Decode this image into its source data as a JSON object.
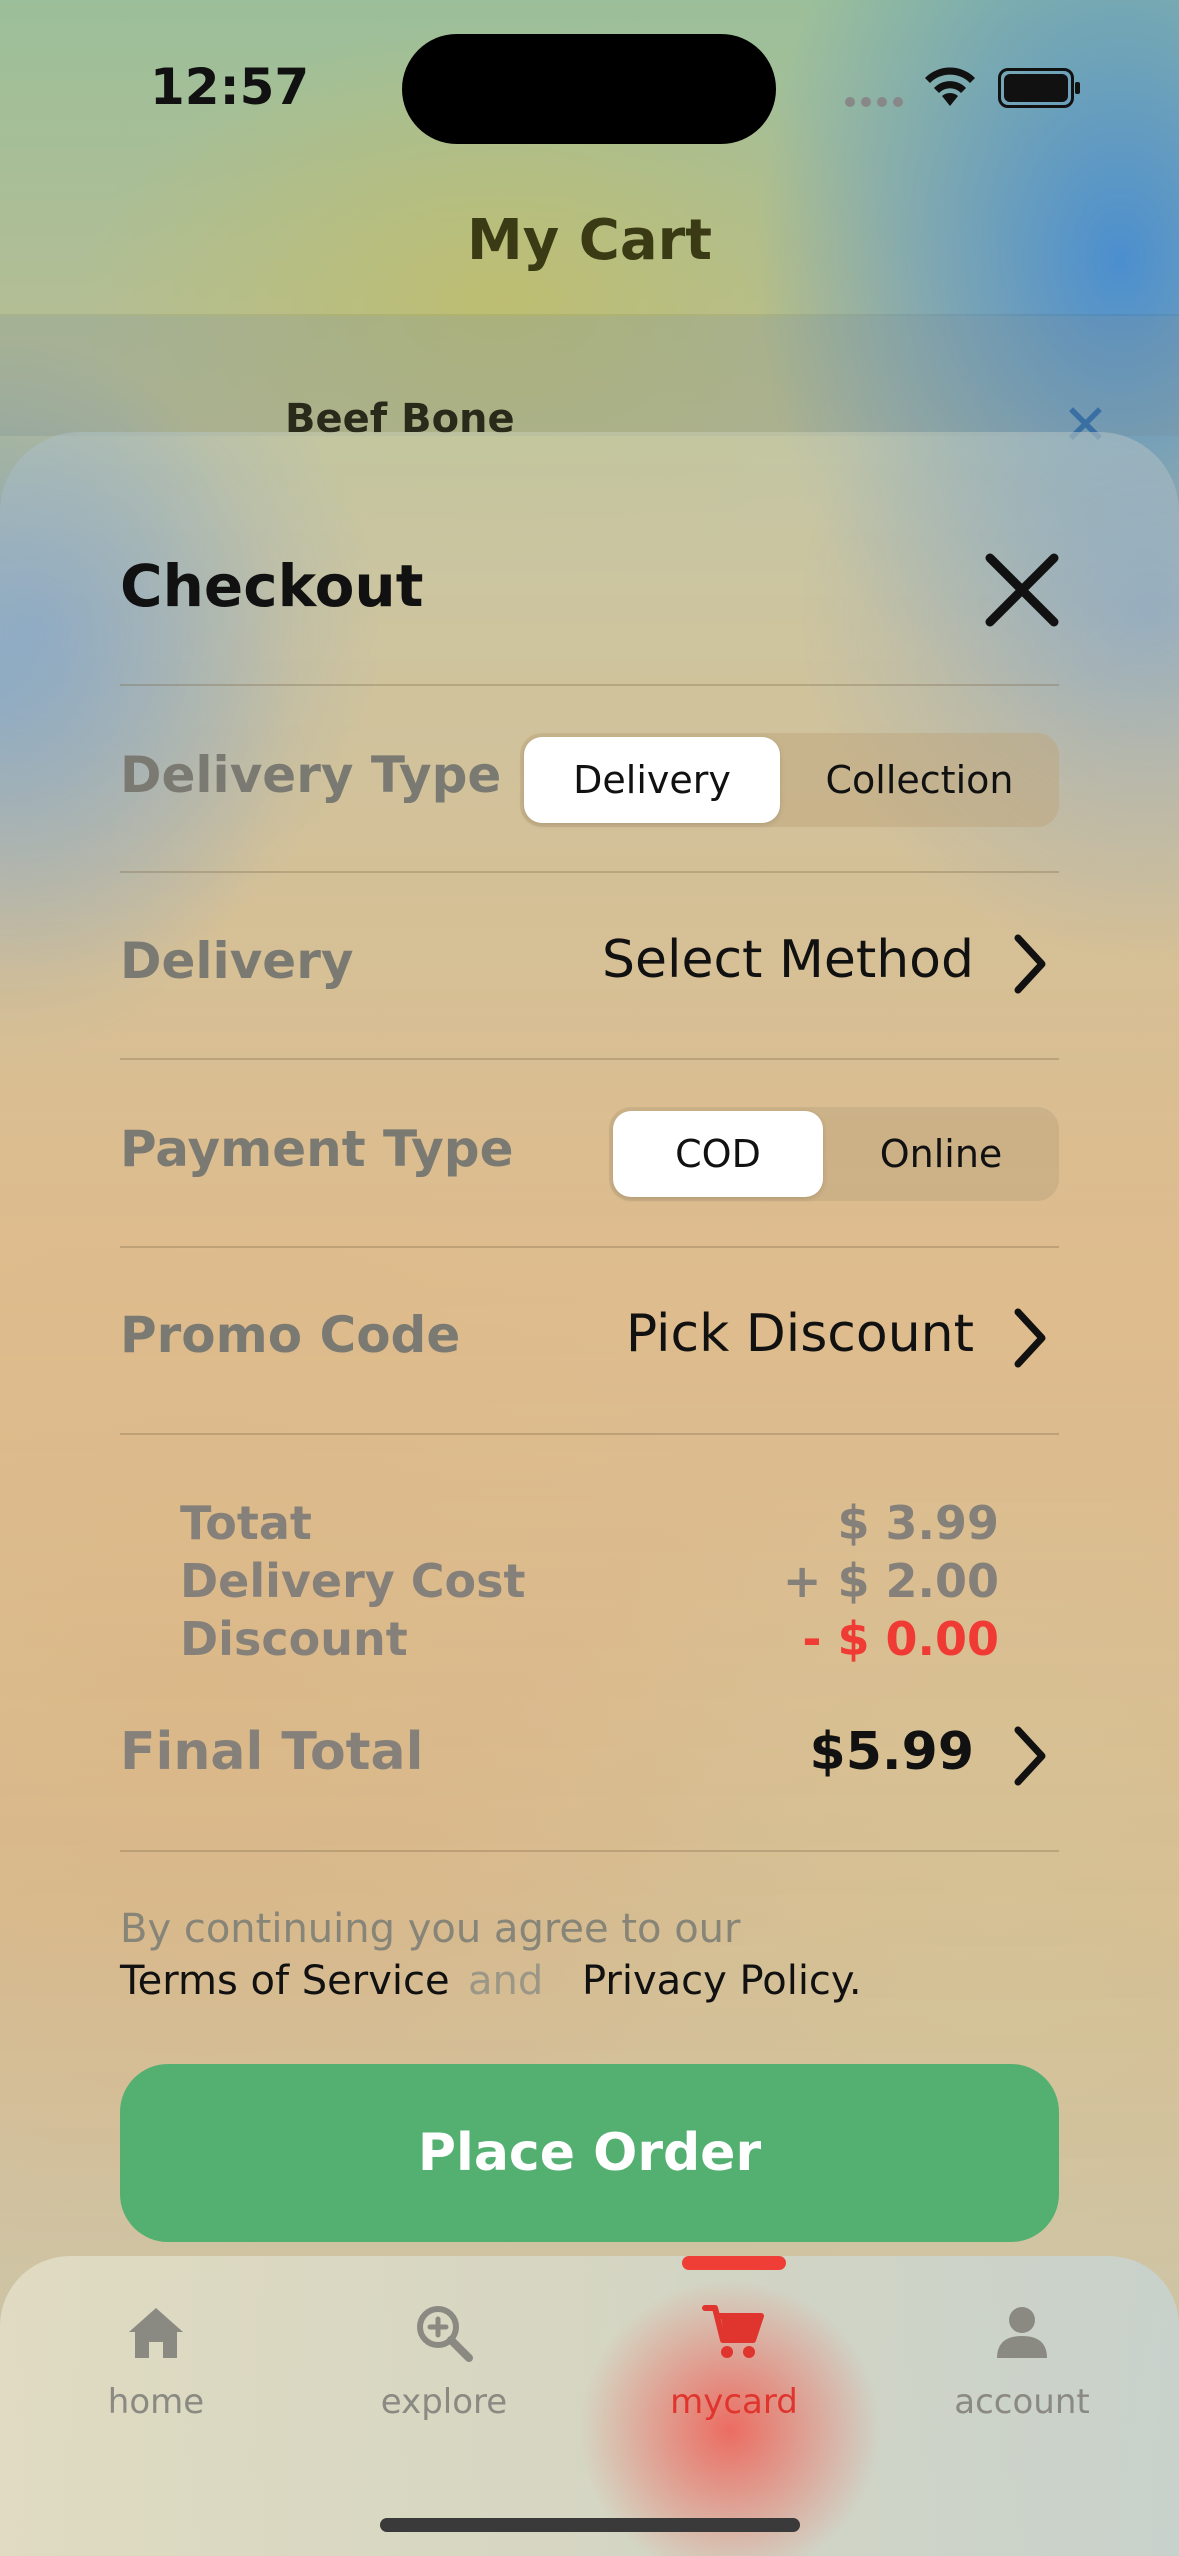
{
  "status_bar": {
    "time": "12:57"
  },
  "header": {
    "title": "My Cart"
  },
  "cart": {
    "item_name": "Beef Bone",
    "remove_icon": "close-icon"
  },
  "checkout": {
    "title": "Checkout",
    "close_icon": "close-icon",
    "delivery_type": {
      "label": "Delivery Type",
      "options": [
        "Delivery",
        "Collection"
      ],
      "selected": "Delivery"
    },
    "delivery": {
      "label": "Delivery",
      "value": "Select Method"
    },
    "payment_type": {
      "label": "Payment Type",
      "options": [
        "COD",
        "Online"
      ],
      "selected": "COD"
    },
    "promo_code": {
      "label": "Promo Code",
      "value": "Pick Discount"
    },
    "summary": {
      "total_label": "Totat",
      "total_value": "$ 3.99",
      "delivery_cost_label": "Delivery Cost",
      "delivery_cost_value": "+ $ 2.00",
      "discount_label": "Discount",
      "discount_value": "- $ 0.00"
    },
    "final_total": {
      "label": "Final Total",
      "value": "$5.99"
    },
    "terms": {
      "intro": "By continuing you agree to our",
      "terms_link": "Terms of Service",
      "and": "and",
      "privacy_link": "Privacy Policy."
    },
    "place_order_label": "Place Order"
  },
  "tabbar": {
    "items": [
      {
        "label": "home",
        "icon": "home-icon"
      },
      {
        "label": "explore",
        "icon": "explore-icon"
      },
      {
        "label": "mycard",
        "icon": "cart-icon"
      },
      {
        "label": "account",
        "icon": "account-icon"
      }
    ],
    "active": "mycard"
  },
  "colors": {
    "accent_green": "#54b071",
    "accent_red": "#ee3e36",
    "discount_red": "#ef3b34",
    "header_title": "#3a3a15"
  }
}
